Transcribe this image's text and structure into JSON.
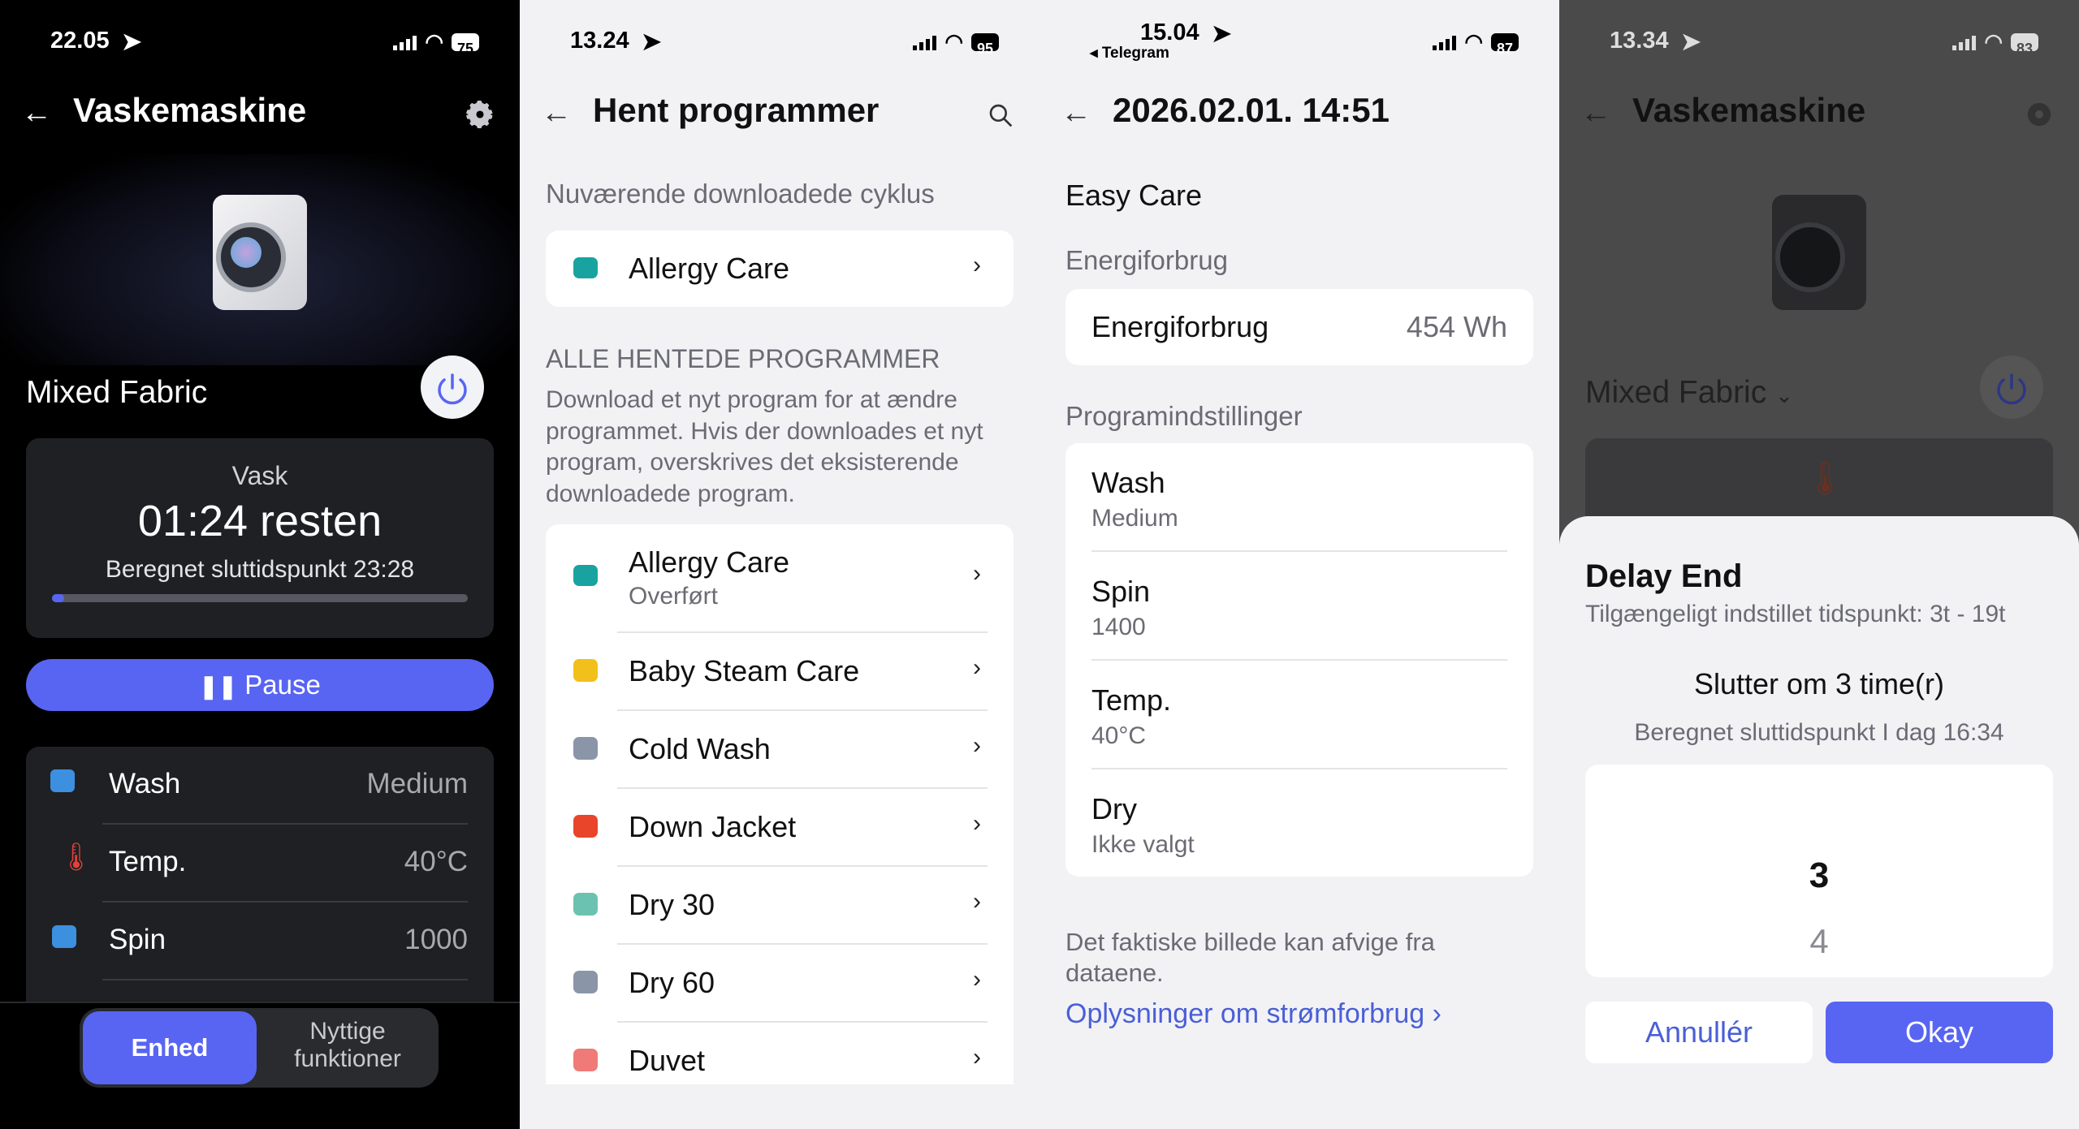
{
  "p1": {
    "time": "22.05",
    "battery": "75",
    "title": "Vaskemaskine",
    "program": "Mixed Fabric",
    "status_label": "Vask",
    "remaining": "01:24 resten",
    "end_time": "Beregnet sluttidspunkt 23:28",
    "progress": 0.03,
    "pause_label": "Pause",
    "settings": [
      {
        "icon": "wash-icon",
        "label": "Wash",
        "value": "Medium"
      },
      {
        "icon": "thermometer-icon",
        "label": "Temp.",
        "value": "40°C"
      },
      {
        "icon": "spin-icon",
        "label": "Spin",
        "value": "1000"
      }
    ],
    "tabs": {
      "active": "Enhed",
      "other_line1": "Nyttige",
      "other_line2": "funktioner"
    }
  },
  "p2": {
    "time": "13.24",
    "battery": "95",
    "title": "Hent programmer",
    "current_heading": "Nuværende downloadede cyklus",
    "current_item": "Allergy Care",
    "all_heading": "ALLE HENTEDE PROGRAMMER",
    "description": "Download et nyt program for at ændre programmet. Hvis der downloades et nyt program, overskrives det eksisterende downloadede program.",
    "items": [
      {
        "label": "Allergy Care",
        "sub": "Overført",
        "icon": "allergy-icon",
        "color": "#19a3a0"
      },
      {
        "label": "Baby Steam Care",
        "sub": "",
        "icon": "baby-icon",
        "color": "#f2c01b"
      },
      {
        "label": "Cold Wash",
        "sub": "",
        "icon": "cold-wash-icon",
        "color": "#8a95a8"
      },
      {
        "label": "Down Jacket",
        "sub": "",
        "icon": "jacket-icon",
        "color": "#e8452a"
      },
      {
        "label": "Dry 30",
        "sub": "",
        "icon": "dry30-icon",
        "color": "#6cc2b0"
      },
      {
        "label": "Dry 60",
        "sub": "",
        "icon": "dry60-icon",
        "color": "#8a95a8"
      },
      {
        "label": "Duvet",
        "sub": "",
        "icon": "duvet-icon",
        "color": "#f07a78"
      }
    ]
  },
  "p3": {
    "time": "15.04",
    "back_app": "◂ Telegram",
    "battery": "87",
    "title": "2026.02.01. 14:51",
    "program": "Easy Care",
    "energy_heading": "Energiforbrug",
    "energy_label": "Energiforbrug",
    "energy_value": "454 Wh",
    "settings_heading": "Programindstillinger",
    "settings": [
      {
        "label": "Wash",
        "value": "Medium"
      },
      {
        "label": "Spin",
        "value": "1400"
      },
      {
        "label": "Temp.",
        "value": "40°C"
      },
      {
        "label": "Dry",
        "value": "Ikke valgt"
      }
    ],
    "disclaimer": "Det faktiske billede kan afvige fra dataene.",
    "link": "Oplysninger om strømforbrug"
  },
  "p4": {
    "time": "13.34",
    "battery": "83",
    "title": "Vaskemaskine",
    "program": "Mixed Fabric",
    "sheet_title": "Delay End",
    "sheet_sub": "Tilgængeligt indstillet tidspunkt: 3t - 19t",
    "ends_in": "Slutter om 3 time(r)",
    "end_estimate": "Beregnet sluttidspunkt I dag 16:34",
    "picker_selected": "3",
    "picker_next": "4",
    "cancel": "Annullér",
    "ok": "Okay"
  },
  "colors": {
    "accent": "#5865f2",
    "link": "#4a5fd6",
    "gray_text": "#6b6b74"
  }
}
